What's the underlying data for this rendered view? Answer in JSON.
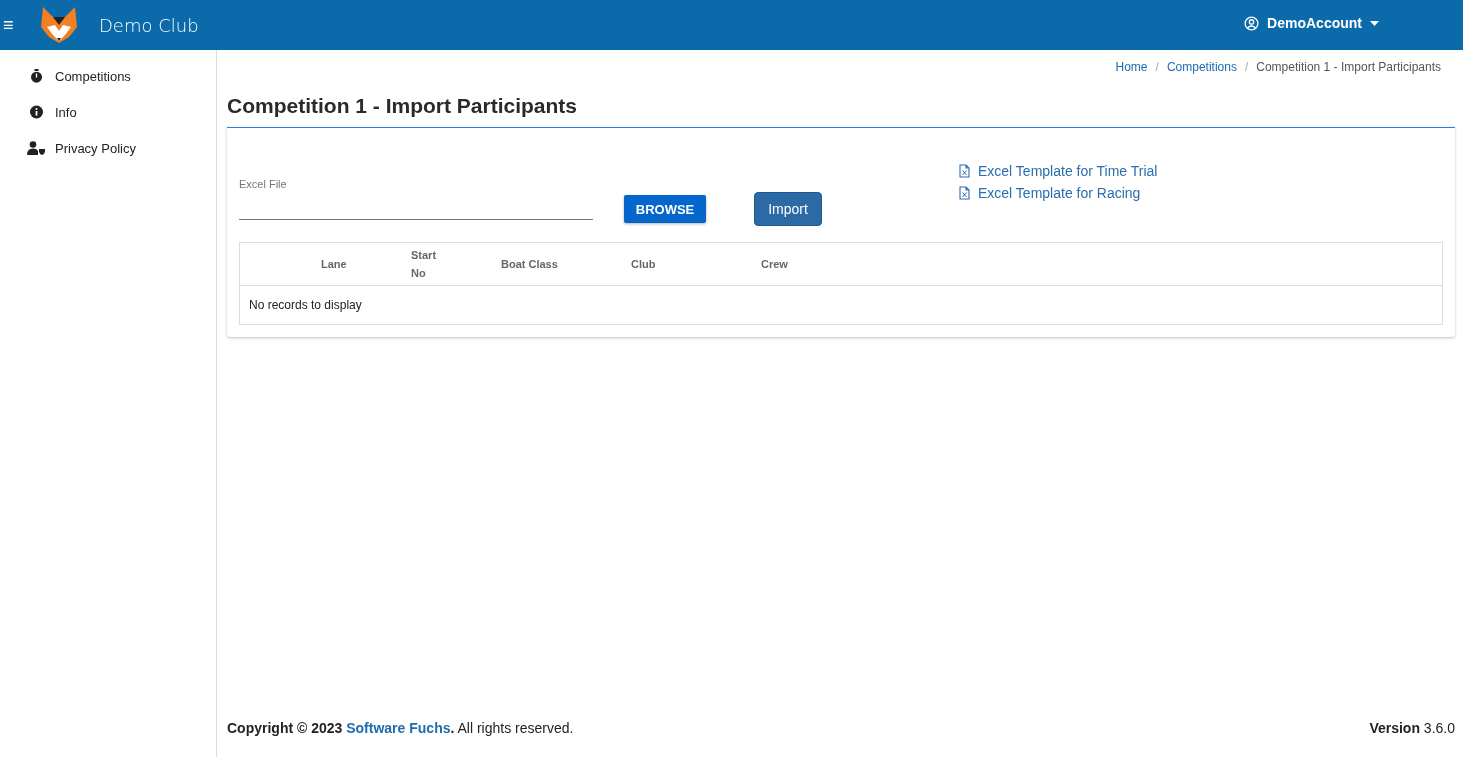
{
  "header": {
    "menu_glyph": "≡",
    "title": "Demo Club",
    "account": "DemoAccount"
  },
  "sidebar": {
    "items": [
      {
        "label": "Competitions"
      },
      {
        "label": "Info"
      },
      {
        "label": "Privacy Policy"
      }
    ]
  },
  "breadcrumb": [
    {
      "label": "Home",
      "kind": "link"
    },
    {
      "label": "Competitions",
      "kind": "link",
      "separator": "/"
    },
    {
      "label": "Competition 1 - Import Participants",
      "kind": "current",
      "separator": "/"
    }
  ],
  "page_title": "Competition 1 - Import Participants",
  "form": {
    "file_label": "Excel File",
    "browse": "BROWSE",
    "import": "Import"
  },
  "templates": [
    {
      "label": "Excel Template for Time Trial"
    },
    {
      "label": "Excel Template for Racing"
    }
  ],
  "table": {
    "columns": [
      "Lane",
      "Start No",
      "Boat Class",
      "Club",
      "Crew"
    ],
    "empty": "No records to display"
  },
  "footer": {
    "prefix": "**Copyright © 2023** ",
    "link": "Software Fuchs",
    "suffix": "**.** All rights reserved.",
    "version": "**Version** 3.6.0"
  }
}
